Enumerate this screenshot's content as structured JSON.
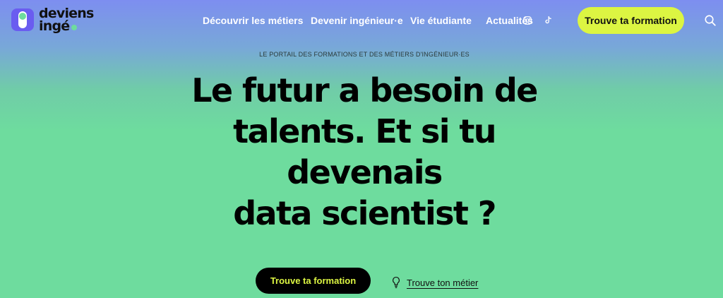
{
  "logo": {
    "line1": "deviens",
    "line2": "ingé"
  },
  "nav": {
    "items": [
      {
        "label": "Découvrir les métiers"
      },
      {
        "label": "Devenir ingénieur·e"
      },
      {
        "label": "Vie étudiante"
      },
      {
        "label": "Actualités"
      }
    ],
    "social": [
      "instagram-icon",
      "tiktok-icon"
    ],
    "cta_label": "Trouve ta formation",
    "search_icon": "search-icon"
  },
  "hero": {
    "kicker": "LE PORTAIL DES FORMATIONS ET DES MÉTIERS D'INGÉNIEUR·ES",
    "headline_lines": [
      "Le futur a besoin de",
      "talents. Et si tu",
      "devenais",
      "data scientist ?"
    ],
    "primary_cta": "Trouve ta formation",
    "secondary_link": "Trouve ton métier",
    "secondary_icon": "lightbulb-icon"
  },
  "colors": {
    "accent_lime": "#dcf542",
    "brand_purple": "#6a5cf0",
    "brand_green": "#6edc9e",
    "top_gradient": "#7d8ef0"
  }
}
